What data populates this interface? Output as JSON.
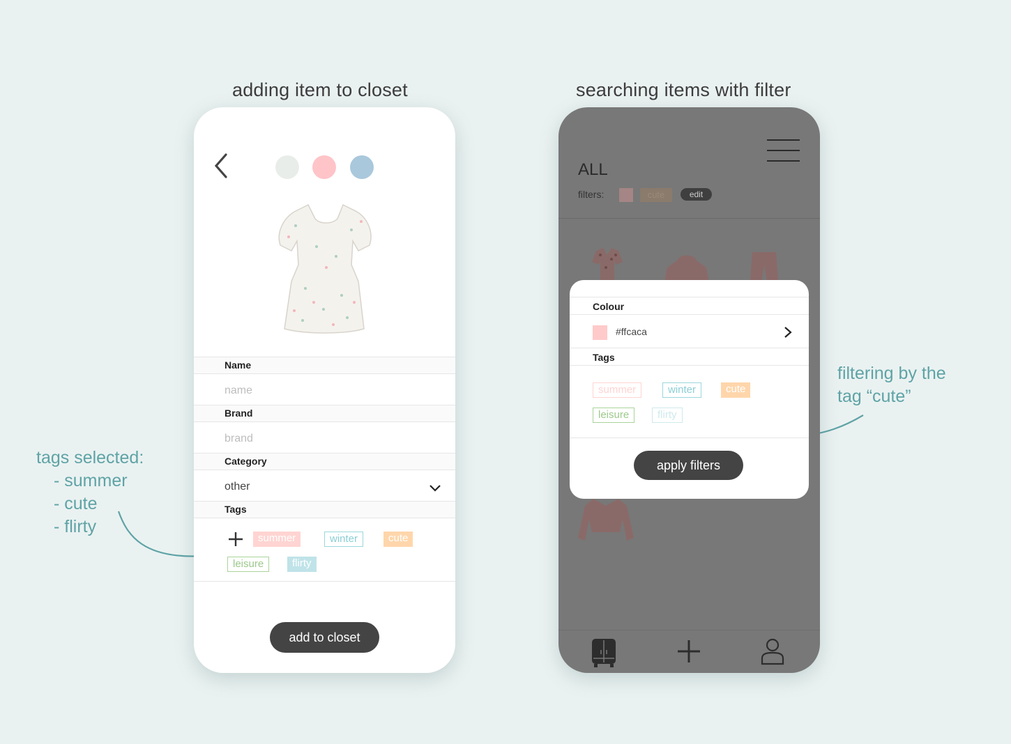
{
  "captions": {
    "left": "adding item to closet",
    "right": "searching items with filter"
  },
  "annotations": {
    "left": [
      "tags selected:",
      "- summer",
      "- cute",
      "- flirty"
    ],
    "right": [
      "filtering by the",
      "tag “cute”"
    ]
  },
  "add_screen": {
    "color_swatches": [
      "#e9ede9",
      "#ffc4c8",
      "#a9c8dc"
    ],
    "fields": {
      "name_label": "Name",
      "name_placeholder": "name",
      "brand_label": "Brand",
      "brand_placeholder": "brand",
      "category_label": "Category",
      "category_value": "other",
      "tags_label": "Tags"
    },
    "tags": [
      {
        "label": "summer",
        "style": "filled",
        "color": "#ffd4d2"
      },
      {
        "label": "winter",
        "style": "outline",
        "color": "#9bd7dc"
      },
      {
        "label": "cute",
        "style": "filled",
        "color": "#ffd6ab"
      },
      {
        "label": "leisure",
        "style": "outline",
        "color": "#a9d49a"
      },
      {
        "label": "flirty",
        "style": "filled",
        "color": "#bfe3e8"
      }
    ],
    "add_button": "add to closet"
  },
  "closet_screen": {
    "title": "ALL",
    "filters_label": "filters:",
    "active_filter_tag": "cute",
    "edit_label": "edit",
    "modal": {
      "colour_label": "Colour",
      "colour_value": "#ffcaca",
      "colour_swatch": "#ffcaca",
      "tags_label": "Tags",
      "tags": [
        {
          "label": "summer",
          "style": "outline-faded",
          "color": "#ffd4d2"
        },
        {
          "label": "winter",
          "style": "outline",
          "color": "#9bd7dc"
        },
        {
          "label": "cute",
          "style": "filled",
          "color": "#ffd6ab"
        },
        {
          "label": "leisure",
          "style": "outline",
          "color": "#a9d49a"
        },
        {
          "label": "flirty",
          "style": "outline-faded",
          "color": "#bfe3e8"
        }
      ],
      "apply_button": "apply filters"
    },
    "nav": [
      "closet-icon",
      "plus-icon",
      "user-icon"
    ]
  },
  "colors": {
    "background": "#eaf2f1",
    "annotation": "#5fa3a6",
    "button": "#444444"
  }
}
